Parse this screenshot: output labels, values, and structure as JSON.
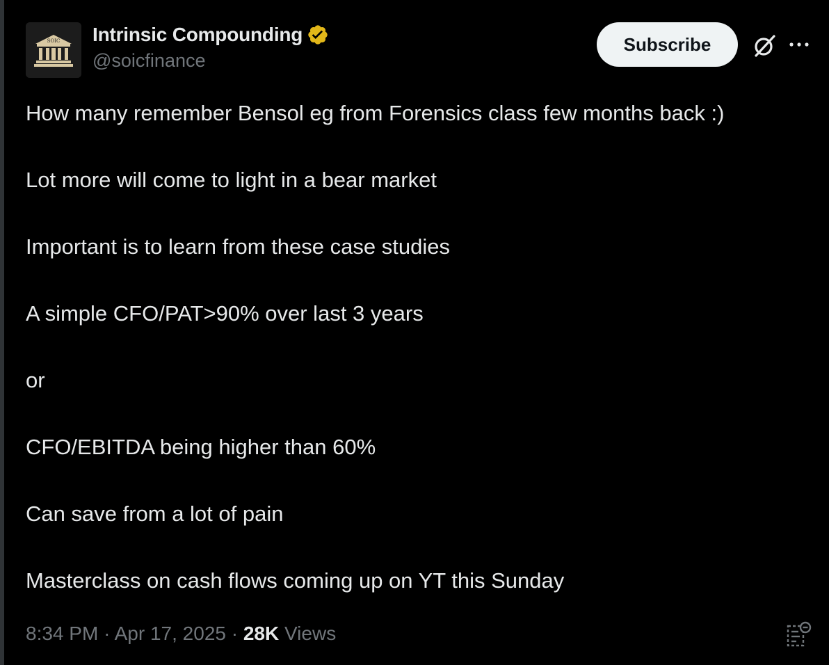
{
  "author": {
    "display_name": "Intrinsic Compounding",
    "handle": "@soicfinance",
    "avatar_icon": "bank-building-logo",
    "avatar_text": "SOIC",
    "verified": true,
    "verified_color": "#e2b719"
  },
  "actions": {
    "subscribe_label": "Subscribe",
    "grok_icon": "grok-icon",
    "more_icon": "more-icon"
  },
  "post": {
    "lines": [
      "How many remember Bensol eg from Forensics class few months back :)",
      "Lot more will come to light in a bear market",
      "Important is to learn from these case studies",
      "A simple CFO/PAT>90% over last 3 years",
      "or",
      "CFO/EBITDA being higher than 60%",
      "Can save from a lot of pain",
      "Masterclass on cash flows coming up on YT this Sunday"
    ]
  },
  "meta": {
    "time": "8:34 PM",
    "separator": "·",
    "date": "Apr 17, 2025",
    "views_count": "28K",
    "views_label": "Views",
    "analytics_icon": "analytics-icon"
  },
  "colors": {
    "background": "#000000",
    "text": "#e7e9ea",
    "secondary": "#71767b",
    "button_bg": "#eff3f4"
  }
}
